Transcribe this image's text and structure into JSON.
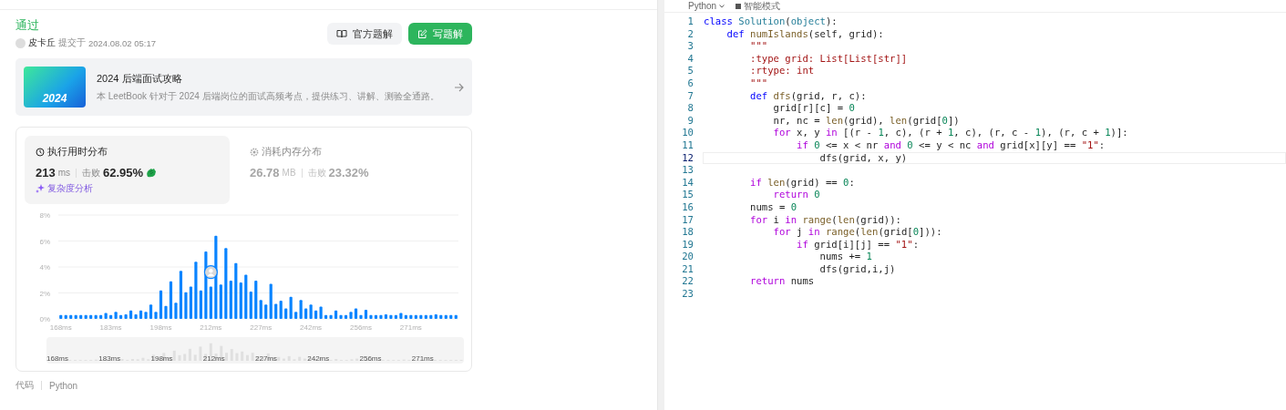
{
  "result": {
    "status": "通过",
    "user": "皮卡丘",
    "submitted_label": "提交于",
    "submitted_time": "2024.08.02 05:17"
  },
  "actions": [
    {
      "label": "官方题解",
      "kind": "secondary"
    },
    {
      "label": "写题解",
      "kind": "primary"
    }
  ],
  "banner": {
    "image_text": "2024",
    "title": "2024 后端面试攻略",
    "description": "本 LeetBook 针对于 2024 后端岗位的面试高频考点，提供练习、讲解、测验全通路。"
  },
  "stats": [
    {
      "kind": "time",
      "title": "执行用时分布",
      "value": "213",
      "unit": "ms",
      "beat_label": "击败",
      "beat": "62.95%",
      "selected": true,
      "link": "复杂度分析"
    },
    {
      "kind": "memory",
      "title": "消耗内存分布",
      "value": "26.78",
      "unit": "MB",
      "beat_label": "击败",
      "beat": "23.32%",
      "selected": false
    }
  ],
  "chart_data": {
    "type": "bar",
    "grid": true,
    "ylim": [
      0,
      8
    ],
    "yticks": [
      {
        "value": 0,
        "label": "0%"
      },
      {
        "value": 2,
        "label": "2%"
      },
      {
        "value": 4,
        "label": "4%"
      },
      {
        "value": 6,
        "label": "6%"
      },
      {
        "value": 8,
        "label": "8%"
      }
    ],
    "categories": [
      "168ms",
      null,
      null,
      null,
      null,
      null,
      null,
      null,
      null,
      null,
      "183ms",
      null,
      null,
      null,
      null,
      null,
      null,
      null,
      null,
      null,
      "198ms",
      null,
      null,
      null,
      null,
      null,
      null,
      null,
      null,
      null,
      "212ms",
      null,
      null,
      null,
      null,
      null,
      null,
      null,
      null,
      null,
      "227ms",
      null,
      null,
      null,
      null,
      null,
      null,
      null,
      null,
      null,
      "242ms",
      null,
      null,
      null,
      null,
      null,
      null,
      null,
      null,
      null,
      "256ms",
      null,
      null,
      null,
      null,
      null,
      null,
      null,
      null,
      null,
      "271ms",
      null,
      null,
      null,
      null,
      null,
      null,
      null,
      null,
      null
    ],
    "series": [
      {
        "color": "#0a84ff",
        "values": [
          0.3,
          0.3,
          0.3,
          0.3,
          0.3,
          0.3,
          0.3,
          0.3,
          0.3,
          0.45,
          0.3,
          0.55,
          0.3,
          0.35,
          0.65,
          0.35,
          0.65,
          0.55,
          1.1,
          0.55,
          2.2,
          1.0,
          2.9,
          1.25,
          3.7,
          2.05,
          2.5,
          4.4,
          2.2,
          5.2,
          2.5,
          6.4,
          2.65,
          5.45,
          2.95,
          4.3,
          2.8,
          3.4,
          2.1,
          2.95,
          1.45,
          1.1,
          2.7,
          1.15,
          1.4,
          0.8,
          1.7,
          0.55,
          1.45,
          0.8,
          1.1,
          0.65,
          0.95,
          0.3,
          0.3,
          0.65,
          0.3,
          0.3,
          0.55,
          0.8,
          0.3,
          0.7,
          0.3,
          0.3,
          0.3,
          0.35,
          0.3,
          0.3,
          0.45,
          0.3,
          0.3,
          0.3,
          0.3,
          0.3,
          0.3,
          0.35,
          0.3,
          0.3,
          0.3,
          0.3
        ]
      }
    ]
  },
  "navigator_labels": [
    "168ms",
    "183ms",
    "198ms",
    "212ms",
    "227ms",
    "242ms",
    "256ms",
    "271ms"
  ],
  "code_label": "代码",
  "code_language": "Python",
  "editor": {
    "language": "Python",
    "mode": "智能模式",
    "lines": [
      {
        "number": "1",
        "current": false,
        "tokens": [
          {
            "kind": "kw",
            "text": "class "
          },
          {
            "kind": "cls",
            "text": "Solution"
          },
          {
            "kind": "p",
            "text": "("
          },
          {
            "kind": "cls",
            "text": "object"
          },
          {
            "kind": "p",
            "text": "):"
          }
        ]
      },
      {
        "number": "2",
        "current": false,
        "tokens": [
          {
            "kind": "kw",
            "text": "    def "
          },
          {
            "kind": "fn",
            "text": "numIslands"
          },
          {
            "kind": "p",
            "text": "(self, grid):"
          }
        ]
      },
      {
        "number": "3",
        "current": false,
        "tokens": [
          {
            "kind": "str",
            "text": "        \"\"\""
          }
        ]
      },
      {
        "number": "4",
        "current": false,
        "tokens": [
          {
            "kind": "str",
            "text": "        :type grid: List[List[str]]"
          }
        ]
      },
      {
        "number": "5",
        "current": false,
        "tokens": [
          {
            "kind": "str",
            "text": "        :rtype: int"
          }
        ]
      },
      {
        "number": "6",
        "current": false,
        "tokens": [
          {
            "kind": "str",
            "text": "        \"\"\""
          }
        ]
      },
      {
        "number": "7",
        "current": false,
        "tokens": [
          {
            "kind": "kw",
            "text": "        def "
          },
          {
            "kind": "fn",
            "text": "dfs"
          },
          {
            "kind": "p",
            "text": "(grid, r, c):"
          }
        ]
      },
      {
        "number": "8",
        "current": false,
        "tokens": [
          {
            "kind": "p",
            "text": "            grid[r][c] = "
          },
          {
            "kind": "num",
            "text": "0"
          }
        ]
      },
      {
        "number": "9",
        "current": false,
        "tokens": [
          {
            "kind": "p",
            "text": "            nr, nc = "
          },
          {
            "kind": "fn",
            "text": "len"
          },
          {
            "kind": "p",
            "text": "(grid), "
          },
          {
            "kind": "fn",
            "text": "len"
          },
          {
            "kind": "p",
            "text": "(grid["
          },
          {
            "kind": "num",
            "text": "0"
          },
          {
            "kind": "p",
            "text": "])"
          }
        ]
      },
      {
        "number": "10",
        "current": false,
        "tokens": [
          {
            "kind": "ctl",
            "text": "            for"
          },
          {
            "kind": "p",
            "text": " x, y "
          },
          {
            "kind": "ctl",
            "text": "in"
          },
          {
            "kind": "p",
            "text": " [(r - "
          },
          {
            "kind": "num",
            "text": "1"
          },
          {
            "kind": "p",
            "text": ", c), (r + "
          },
          {
            "kind": "num",
            "text": "1"
          },
          {
            "kind": "p",
            "text": ", c), (r, c - "
          },
          {
            "kind": "num",
            "text": "1"
          },
          {
            "kind": "p",
            "text": "), (r, c + "
          },
          {
            "kind": "num",
            "text": "1"
          },
          {
            "kind": "p",
            "text": ")]:"
          }
        ]
      },
      {
        "number": "11",
        "current": false,
        "tokens": [
          {
            "kind": "ctl",
            "text": "                if "
          },
          {
            "kind": "num",
            "text": "0"
          },
          {
            "kind": "p",
            "text": " <= x < nr "
          },
          {
            "kind": "ctl",
            "text": "and "
          },
          {
            "kind": "num",
            "text": "0"
          },
          {
            "kind": "p",
            "text": " <= y < nc "
          },
          {
            "kind": "ctl",
            "text": "and"
          },
          {
            "kind": "p",
            "text": " grid[x][y] == "
          },
          {
            "kind": "str",
            "text": "\"1\""
          },
          {
            "kind": "p",
            "text": ":"
          }
        ]
      },
      {
        "number": "12",
        "current": true,
        "tokens": [
          {
            "kind": "p",
            "text": "                    dfs(grid, x, y)"
          }
        ]
      },
      {
        "number": "13",
        "current": false
      },
      {
        "number": "14",
        "current": false,
        "tokens": [
          {
            "kind": "ctl",
            "text": "        if "
          },
          {
            "kind": "fn",
            "text": "len"
          },
          {
            "kind": "p",
            "text": "(grid) == "
          },
          {
            "kind": "num",
            "text": "0"
          },
          {
            "kind": "p",
            "text": ":"
          }
        ]
      },
      {
        "number": "15",
        "current": false,
        "tokens": [
          {
            "kind": "ctl",
            "text": "            return "
          },
          {
            "kind": "num",
            "text": "0"
          }
        ]
      },
      {
        "number": "16",
        "current": false,
        "tokens": [
          {
            "kind": "p",
            "text": "        nums = "
          },
          {
            "kind": "num",
            "text": "0"
          }
        ]
      },
      {
        "number": "17",
        "current": false,
        "tokens": [
          {
            "kind": "ctl",
            "text": "        for"
          },
          {
            "kind": "p",
            "text": " i "
          },
          {
            "kind": "ctl",
            "text": "in "
          },
          {
            "kind": "fn",
            "text": "range"
          },
          {
            "kind": "p",
            "text": "("
          },
          {
            "kind": "fn",
            "text": "len"
          },
          {
            "kind": "p",
            "text": "(grid)):"
          }
        ]
      },
      {
        "number": "18",
        "current": false,
        "tokens": [
          {
            "kind": "ctl",
            "text": "            for"
          },
          {
            "kind": "p",
            "text": " j "
          },
          {
            "kind": "ctl",
            "text": "in "
          },
          {
            "kind": "fn",
            "text": "range"
          },
          {
            "kind": "p",
            "text": "("
          },
          {
            "kind": "fn",
            "text": "len"
          },
          {
            "kind": "p",
            "text": "(grid["
          },
          {
            "kind": "num",
            "text": "0"
          },
          {
            "kind": "p",
            "text": "])):"
          }
        ]
      },
      {
        "number": "19",
        "current": false,
        "tokens": [
          {
            "kind": "ctl",
            "text": "                if"
          },
          {
            "kind": "p",
            "text": " grid[i][j] == "
          },
          {
            "kind": "str",
            "text": "\"1\""
          },
          {
            "kind": "p",
            "text": ":"
          }
        ]
      },
      {
        "number": "20",
        "current": false,
        "tokens": [
          {
            "kind": "p",
            "text": "                    nums += "
          },
          {
            "kind": "num",
            "text": "1"
          }
        ]
      },
      {
        "number": "21",
        "current": false,
        "tokens": [
          {
            "kind": "p",
            "text": "                    dfs(grid,i,j)"
          }
        ]
      },
      {
        "number": "22",
        "current": false,
        "tokens": [
          {
            "kind": "ctl",
            "text": "        return"
          },
          {
            "kind": "p",
            "text": " nums"
          }
        ]
      },
      {
        "number": "23",
        "current": false
      }
    ]
  }
}
